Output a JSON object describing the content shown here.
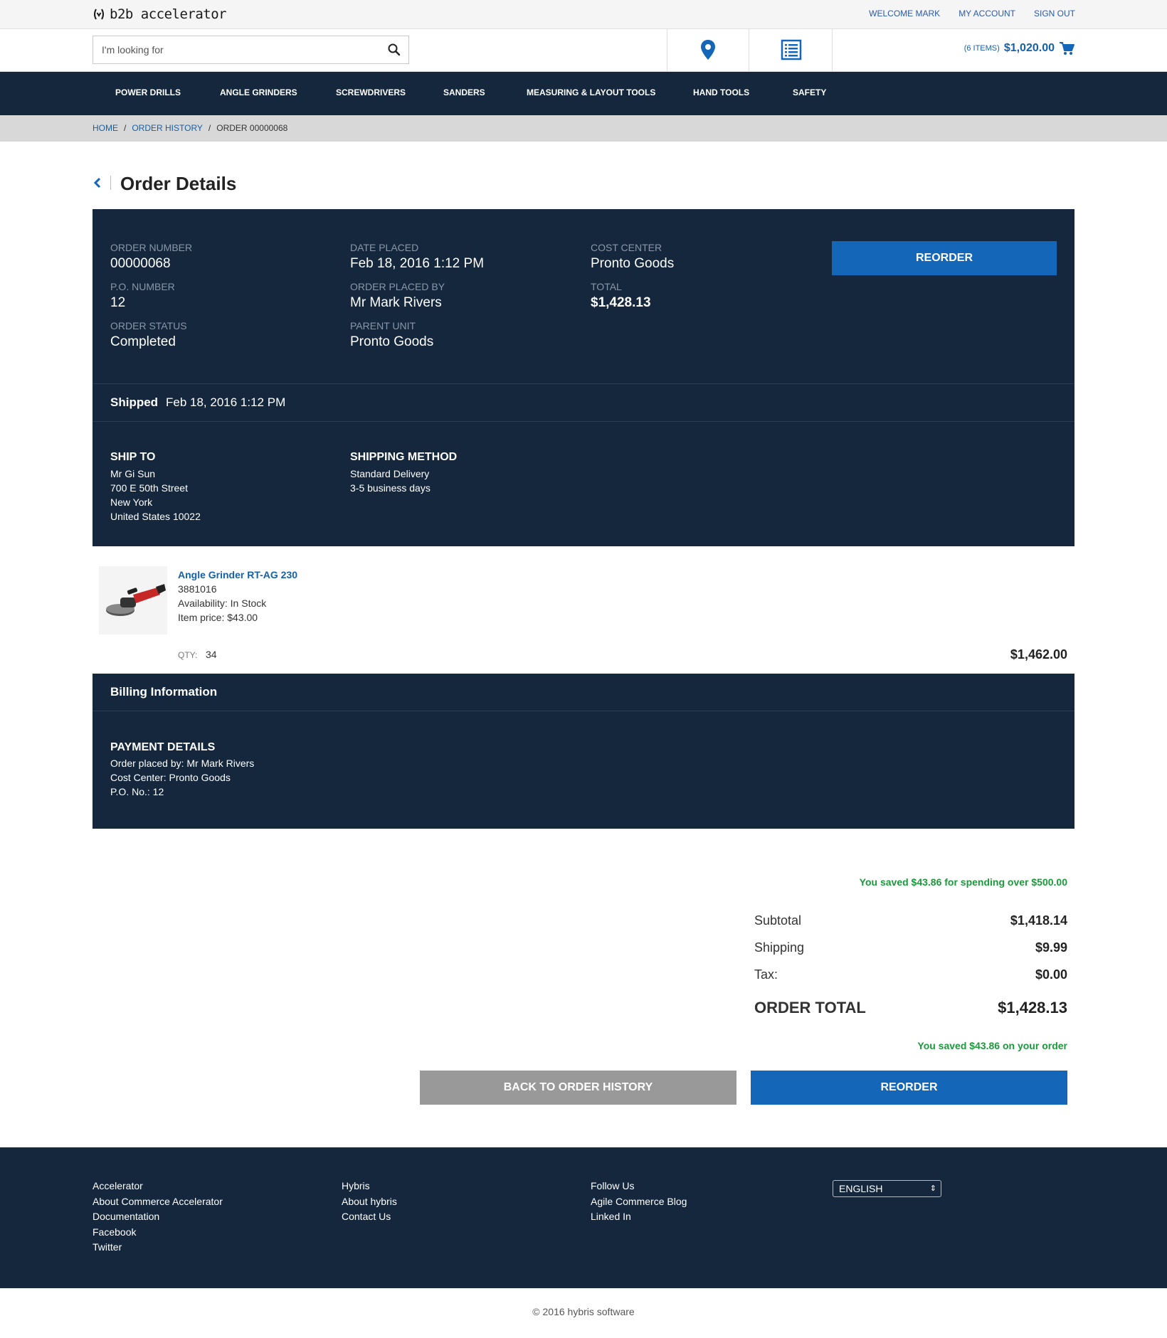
{
  "header": {
    "logo_text": "b2b accelerator",
    "links": [
      "WELCOME MARK",
      "MY ACCOUNT",
      "SIGN OUT"
    ]
  },
  "search": {
    "placeholder": "I'm looking for"
  },
  "cart": {
    "items": "(6 ITEMS)",
    "amount": "$1,020.00"
  },
  "nav": [
    "POWER DRILLS",
    "ANGLE GRINDERS",
    "SCREWDRIVERS",
    "SANDERS",
    "MEASURING & LAYOUT TOOLS",
    "HAND TOOLS",
    "SAFETY"
  ],
  "breadcrumb": {
    "home": "HOME",
    "history": "ORDER HISTORY",
    "current": "ORDER 00000068",
    "sep": "/"
  },
  "page_title": "Order Details",
  "order": {
    "number_label": "ORDER NUMBER",
    "number": "00000068",
    "po_label": "P.O. NUMBER",
    "po": "12",
    "status_label": "ORDER STATUS",
    "status": "Completed",
    "date_label": "DATE PLACED",
    "date": "Feb 18, 2016 1:12 PM",
    "placed_by_label": "ORDER PLACED BY",
    "placed_by": "Mr Mark Rivers",
    "parent_label": "PARENT UNIT",
    "parent": "Pronto Goods",
    "cost_label": "COST CENTER",
    "cost": "Pronto Goods",
    "total_label": "TOTAL",
    "total": "$1,428.13",
    "reorder": "REORDER"
  },
  "shipment": {
    "status": "Shipped",
    "date": "Feb 18, 2016 1:12 PM",
    "ship_to_title": "SHIP TO",
    "ship_to": [
      "Mr  Gi Sun",
      "700 E 50th Street",
      "New York",
      "United States 10022"
    ],
    "method_title": "SHIPPING METHOD",
    "method": [
      "Standard Delivery",
      "3-5 business days"
    ]
  },
  "product": {
    "name": "Angle Grinder RT-AG 230",
    "code": "3881016",
    "availability": "Availability: In Stock",
    "price": "Item price: $43.00",
    "qty_label": "QTY:",
    "qty": "34",
    "line_total": "$1,462.00"
  },
  "billing": {
    "title": "Billing Information",
    "payment_title": "PAYMENT DETAILS",
    "lines": [
      "Order placed by: Mr Mark Rivers",
      "Cost Center: Pronto Goods",
      "P.O. No.: 12"
    ]
  },
  "totals": {
    "promo": "You saved $43.86 for spending over $500.00",
    "subtotal_label": "Subtotal",
    "subtotal": "$1,418.14",
    "shipping_label": "Shipping",
    "shipping": "$9.99",
    "tax_label": "Tax:",
    "tax": "$0.00",
    "order_total_label": "ORDER TOTAL",
    "order_total": "$1,428.13",
    "saved": "You saved $43.86 on your order",
    "back_btn": "BACK TO ORDER HISTORY",
    "reorder_btn": "REORDER"
  },
  "footer": {
    "col1": [
      "Accelerator",
      "About Commerce Accelerator",
      "Documentation",
      "Facebook",
      "Twitter"
    ],
    "col2": [
      "Hybris",
      "About hybris",
      "Contact Us"
    ],
    "col3": [
      "Follow Us",
      "Agile Commerce Blog",
      "Linked In"
    ],
    "language": "ENGLISH",
    "copyright": "© 2016 hybris software"
  },
  "colors": {
    "navy": "#14273d",
    "accent": "#1466b8",
    "success": "#1a9a3a"
  }
}
